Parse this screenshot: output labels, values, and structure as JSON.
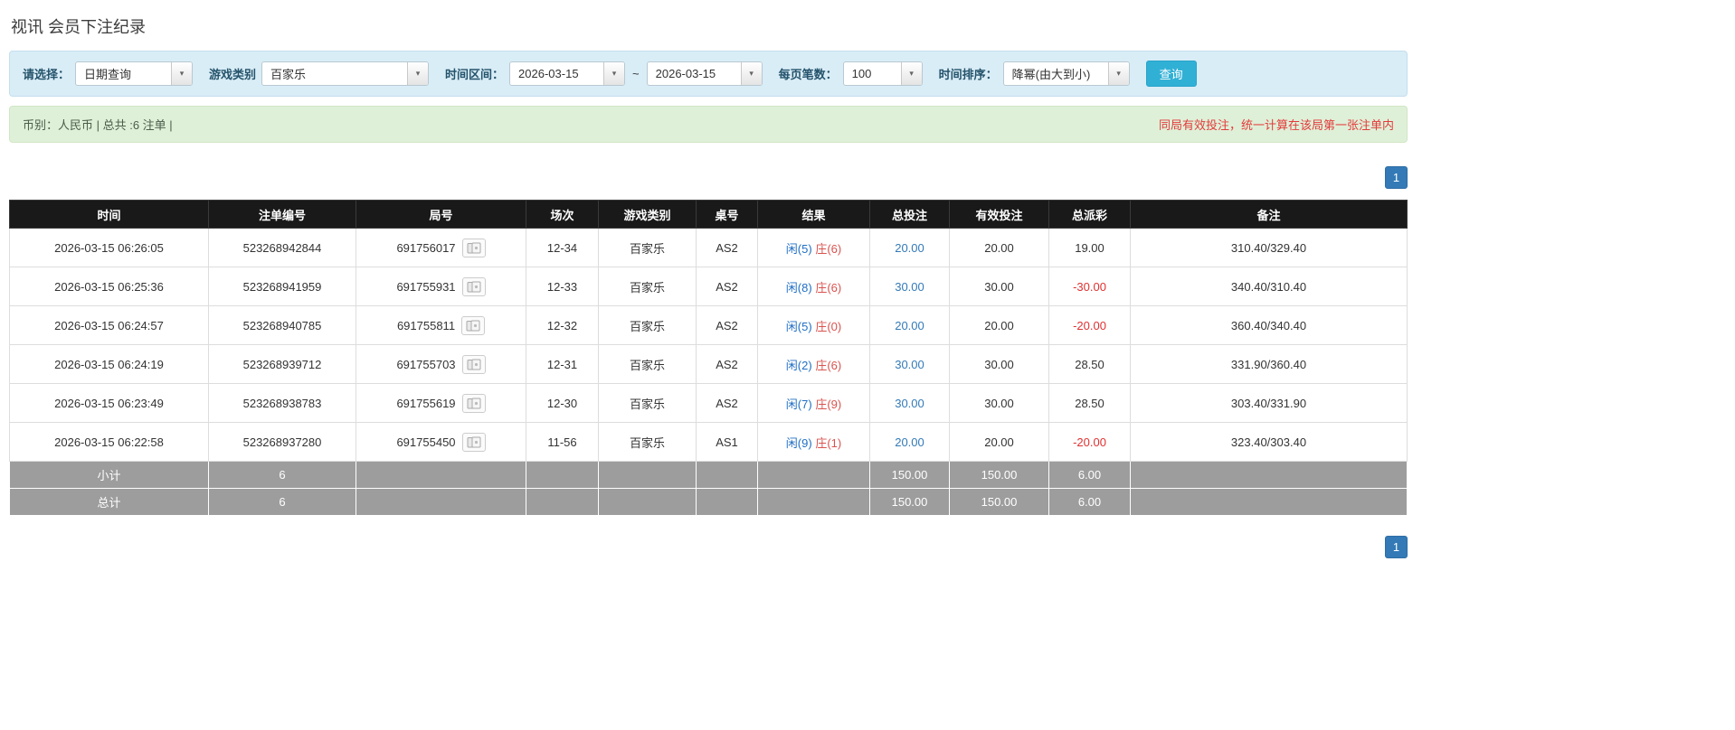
{
  "page": {
    "title": "视讯 会员下注纪录"
  },
  "icons": {
    "chevron_down": "▾"
  },
  "colors": {
    "filter_bar_bg": "#d9edf7",
    "summary_bar_bg": "#dff0d8",
    "header_bg": "#191919",
    "footer_row_bg": "#9d9d9d",
    "accent_blue": "#337ab7",
    "button_blue": "#31b0d5",
    "negative_red": "#e03131",
    "player_blue": "#1f6fc4",
    "banker_red": "#d9534f",
    "note_red": "#e33b3b"
  },
  "filters": {
    "select_label": "请选择：",
    "select_value": "日期查询",
    "game_type_label": "游戏类别",
    "game_type_value": "百家乐",
    "time_range_label": "时间区间：",
    "date_from": "2026-03-15",
    "tilde": "~",
    "date_to": "2026-03-15",
    "page_size_label": "每页笔数：",
    "page_size_value": "100",
    "sort_label": "时间排序：",
    "sort_value": "降幂(由大到小)",
    "search_button": "查询"
  },
  "summary": {
    "left": "币别：人民币 | 总共 :6 注单 |",
    "right": "同局有效投注，统一计算在该局第一张注单内"
  },
  "pagination": {
    "page": "1"
  },
  "table": {
    "headers": [
      "时间",
      "注单编号",
      "局号",
      "场次",
      "游戏类别",
      "桌号",
      "结果",
      "总投注",
      "有效投注",
      "总派彩",
      "备注"
    ],
    "rows": [
      {
        "time": "2026-03-15 06:26:05",
        "bet_id": "523268942844",
        "round": "691756017",
        "session": "12-34",
        "game": "百家乐",
        "table_no": "AS2",
        "result": {
          "player": "闲(5)",
          "banker": "庄(6)"
        },
        "total_bet": "20.00",
        "valid_bet": "20.00",
        "payout": "19.00",
        "note": "310.40/329.40"
      },
      {
        "time": "2026-03-15 06:25:36",
        "bet_id": "523268941959",
        "round": "691755931",
        "session": "12-33",
        "game": "百家乐",
        "table_no": "AS2",
        "result": {
          "player": "闲(8)",
          "banker": "庄(6)"
        },
        "total_bet": "30.00",
        "valid_bet": "30.00",
        "payout": "-30.00",
        "note": "340.40/310.40"
      },
      {
        "time": "2026-03-15 06:24:57",
        "bet_id": "523268940785",
        "round": "691755811",
        "session": "12-32",
        "game": "百家乐",
        "table_no": "AS2",
        "result": {
          "player": "闲(5)",
          "banker": "庄(0)"
        },
        "total_bet": "20.00",
        "valid_bet": "20.00",
        "payout": "-20.00",
        "note": "360.40/340.40"
      },
      {
        "time": "2026-03-15 06:24:19",
        "bet_id": "523268939712",
        "round": "691755703",
        "session": "12-31",
        "game": "百家乐",
        "table_no": "AS2",
        "result": {
          "player": "闲(2)",
          "banker": "庄(6)"
        },
        "total_bet": "30.00",
        "valid_bet": "30.00",
        "payout": "28.50",
        "note": "331.90/360.40"
      },
      {
        "time": "2026-03-15 06:23:49",
        "bet_id": "523268938783",
        "round": "691755619",
        "session": "12-30",
        "game": "百家乐",
        "table_no": "AS2",
        "result": {
          "player": "闲(7)",
          "banker": "庄(9)"
        },
        "total_bet": "30.00",
        "valid_bet": "30.00",
        "payout": "28.50",
        "note": "303.40/331.90"
      },
      {
        "time": "2026-03-15 06:22:58",
        "bet_id": "523268937280",
        "round": "691755450",
        "session": "11-56",
        "game": "百家乐",
        "table_no": "AS1",
        "result": {
          "player": "闲(9)",
          "banker": "庄(1)"
        },
        "total_bet": "20.00",
        "valid_bet": "20.00",
        "payout": "-20.00",
        "note": "323.40/303.40"
      }
    ],
    "footer": [
      {
        "label": "小计",
        "count": "6",
        "total_bet": "150.00",
        "valid_bet": "150.00",
        "payout": "6.00"
      },
      {
        "label": "总计",
        "count": "6",
        "total_bet": "150.00",
        "valid_bet": "150.00",
        "payout": "6.00"
      }
    ]
  }
}
